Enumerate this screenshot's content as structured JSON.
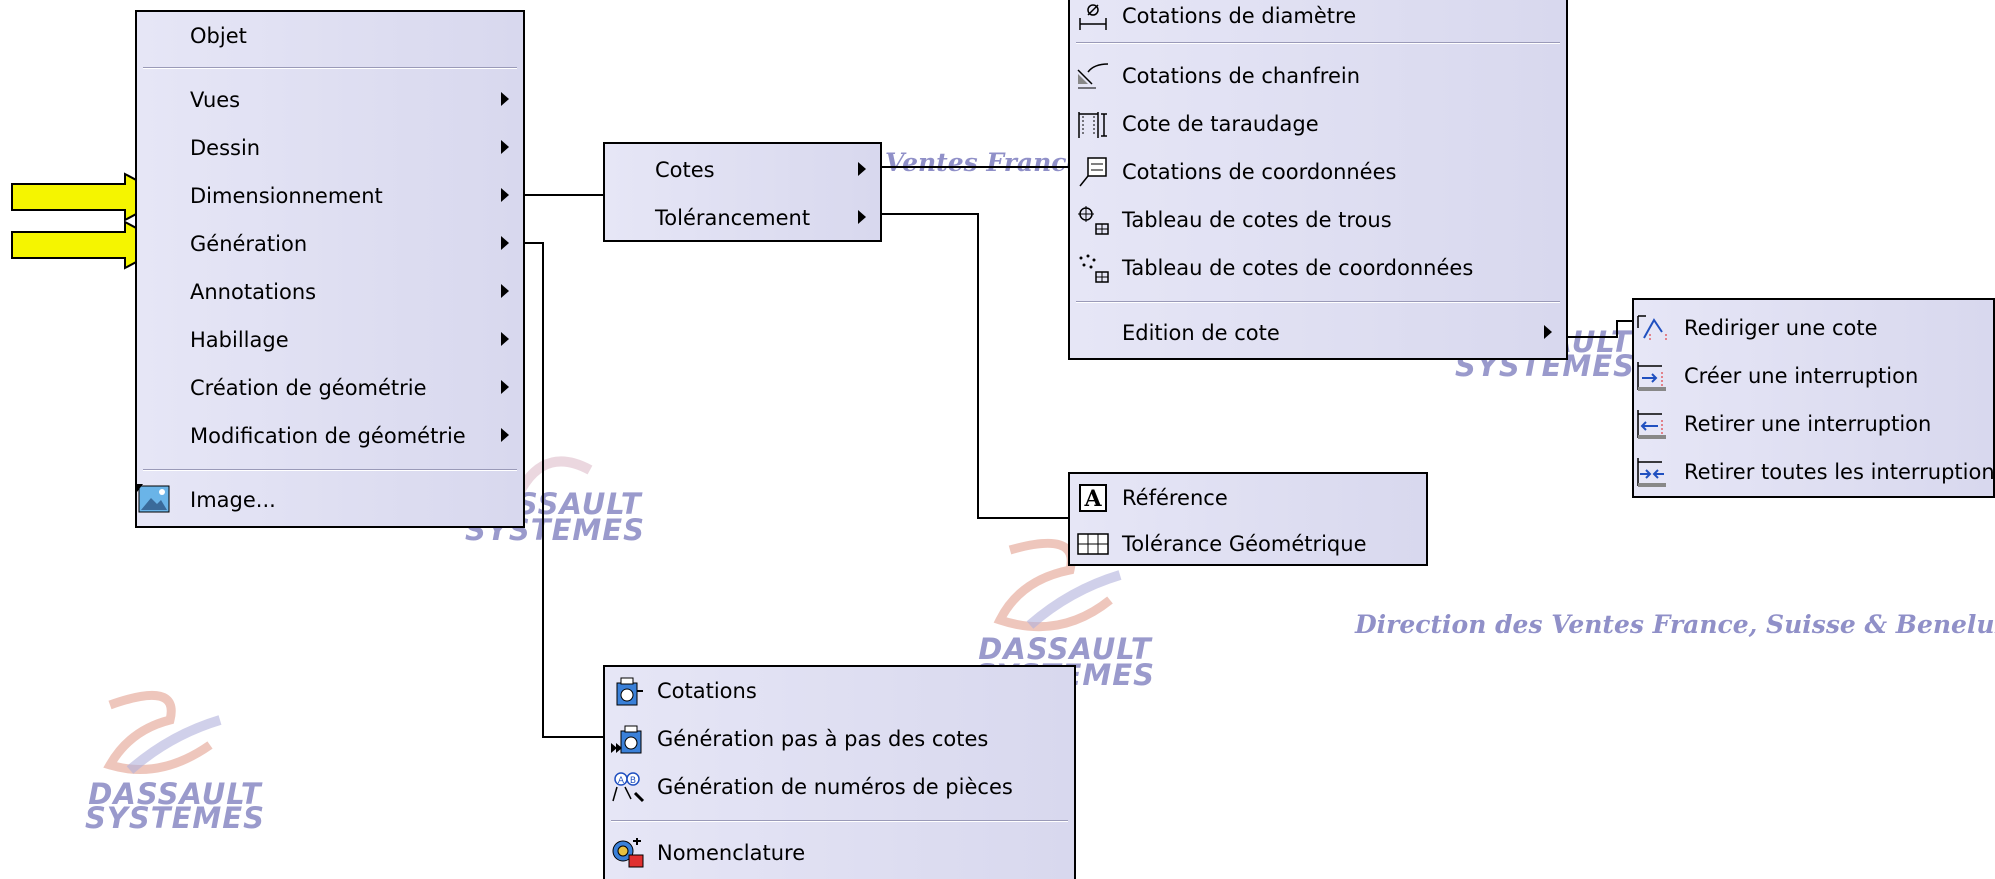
{
  "watermark": {
    "brand_line1": "DASSAULT",
    "brand_line2": "SYSTEMES",
    "direction": "Direction des Ventes France, Suisse & Benelux",
    "fragment": "Ventes France"
  },
  "main_menu": {
    "items": [
      {
        "label": "Objet"
      },
      {
        "label": "Vues"
      },
      {
        "label": "Dessin"
      },
      {
        "label": "Dimensionnement"
      },
      {
        "label": "Génération"
      },
      {
        "label": "Annotations"
      },
      {
        "label": "Habillage"
      },
      {
        "label": "Création de géométrie"
      },
      {
        "label": "Modification de géométrie"
      },
      {
        "label": "Image..."
      }
    ]
  },
  "dim_submenu": {
    "items": [
      {
        "label": "Cotes"
      },
      {
        "label": "Tolérancement"
      }
    ]
  },
  "cotes_menu": {
    "items": [
      {
        "label": "Cotations de diamètre",
        "icon": "diameter-dimension-icon"
      },
      {
        "label": "Cotations de chanfrein",
        "icon": "chamfer-dimension-icon"
      },
      {
        "label": "Cote de taraudage",
        "icon": "thread-dimension-icon"
      },
      {
        "label": "Cotations de coordonnées",
        "icon": "coordinate-dimension-icon"
      },
      {
        "label": "Tableau de cotes de trous",
        "icon": "hole-table-icon"
      },
      {
        "label": "Tableau de cotes de coordonnées",
        "icon": "coordinate-table-icon"
      },
      {
        "label": "Edition de cote"
      }
    ]
  },
  "edition_menu": {
    "items": [
      {
        "label": "Rediriger une cote",
        "icon": "redirect-dimension-icon"
      },
      {
        "label": "Créer une interruption",
        "icon": "create-interruption-icon"
      },
      {
        "label": "Retirer une interruption",
        "icon": "remove-interruption-icon"
      },
      {
        "label": "Retirer toutes les interruptions",
        "icon": "remove-all-interruptions-icon"
      }
    ]
  },
  "tol_menu": {
    "items": [
      {
        "label": "Référence",
        "icon": "datum-reference-icon"
      },
      {
        "label": "Tolérance Géométrique",
        "icon": "geometric-tolerance-icon"
      }
    ]
  },
  "gen_menu": {
    "items": [
      {
        "label": "Cotations",
        "icon": "generate-dimensions-icon"
      },
      {
        "label": "Génération pas à pas des cotes",
        "icon": "step-by-step-generation-icon"
      },
      {
        "label": "Génération de numéros de pièces",
        "icon": "balloon-generation-icon"
      },
      {
        "label": "Nomenclature",
        "icon": "bill-of-material-icon"
      }
    ]
  },
  "colors": {
    "menu_bg": "#dcdcf0",
    "pointer_arrow": "#f5f500",
    "watermark": "#9090c8"
  }
}
